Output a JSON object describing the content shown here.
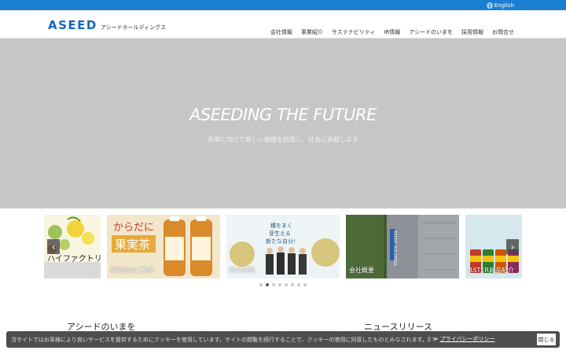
{
  "topbar": {
    "language_label": "English",
    "icon": "globe-icon"
  },
  "header": {
    "logo_main": "ASEED",
    "logo_sub": "アシードホールディングス",
    "nav": [
      "会社情報",
      "事業紹介",
      "サステナビリティ",
      "IR情報",
      "アシードのいまを",
      "採用情報",
      "お問合せ"
    ]
  },
  "hero": {
    "title": "ASEEDING THE FUTURE",
    "subtitle": "未来に向けて新しい価値を創造し、社会に貢献します"
  },
  "carousel": {
    "cards": [
      {
        "label": "ハイファクトリー"
      },
      {
        "label": "新製品のご案内"
      },
      {
        "label": "新卒採用"
      },
      {
        "label": "会社概要"
      },
      {
        "label": "ASTER商品紹介"
      }
    ],
    "prev_icon": "chevron-left-icon",
    "next_icon": "chevron-right-icon",
    "dot_count": 8,
    "active_dot": 1,
    "card2_text": [
      "からだに",
      "果実茶"
    ],
    "card3_text": [
      "種をまく",
      "芽生える",
      "新たな自分!"
    ],
    "brand_sign": "ASEED HOLDINGS"
  },
  "sections": {
    "left_heading": "アシードのいまを",
    "right_heading": "ニュースリリース"
  },
  "cookie": {
    "text": "当サイトではお客様により良いサービスを提供するためにクッキーを使用しています。サイトの閲覧を続行することで、クッキーの使用に同意したものとみなされます。詳細についてはプライバシーポリシーをご覧ください。当サイトではお客様により良いサービスを提供するためにクッキーを使用しています。",
    "link_prefix": "≫",
    "link_label": "プライバシーポリシー",
    "button_label": "閉じる"
  }
}
